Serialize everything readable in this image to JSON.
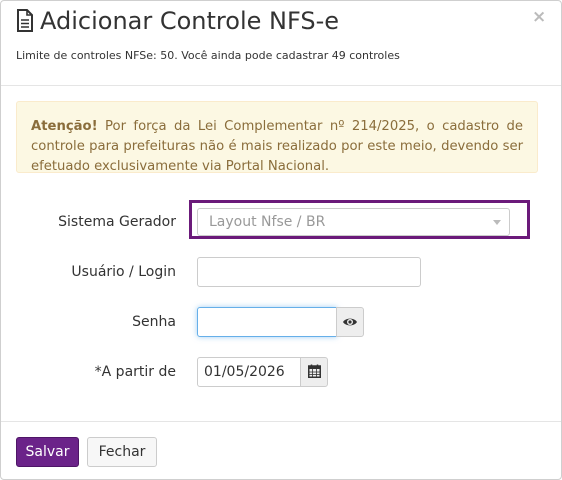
{
  "modal": {
    "title": "Adicionar Controle NFS-e",
    "close_symbol": "×",
    "subtitle": "Limite de controles NFSe: 50. Você ainda pode cadastrar 49 controles"
  },
  "alert": {
    "strong": "Atenção!",
    "text": " Por força da Lei Complementar nº 214/2025, o cadastro de controle para prefeituras não é mais realizado por este meio, devendo ser efetuado exclusivamente via Portal Nacional."
  },
  "form": {
    "sistema_gerador": {
      "label": "Sistema Gerador",
      "placeholder": "Layout Nfse / BR"
    },
    "usuario": {
      "label": "Usuário / Login",
      "value": ""
    },
    "senha": {
      "label": "Senha",
      "value": ""
    },
    "a_partir_de": {
      "label": "*A partir de",
      "value": "01/05/2026"
    }
  },
  "footer": {
    "save_label": "Salvar",
    "close_label": "Fechar"
  },
  "colors": {
    "brand": "#6b2389",
    "highlight": "#6b1a7a",
    "alert_text": "#8a6d3b",
    "alert_bg": "#fcf8e3"
  },
  "icons": [
    "document-icon",
    "close-icon",
    "eye-icon",
    "calendar-icon",
    "chevron-down-icon"
  ]
}
